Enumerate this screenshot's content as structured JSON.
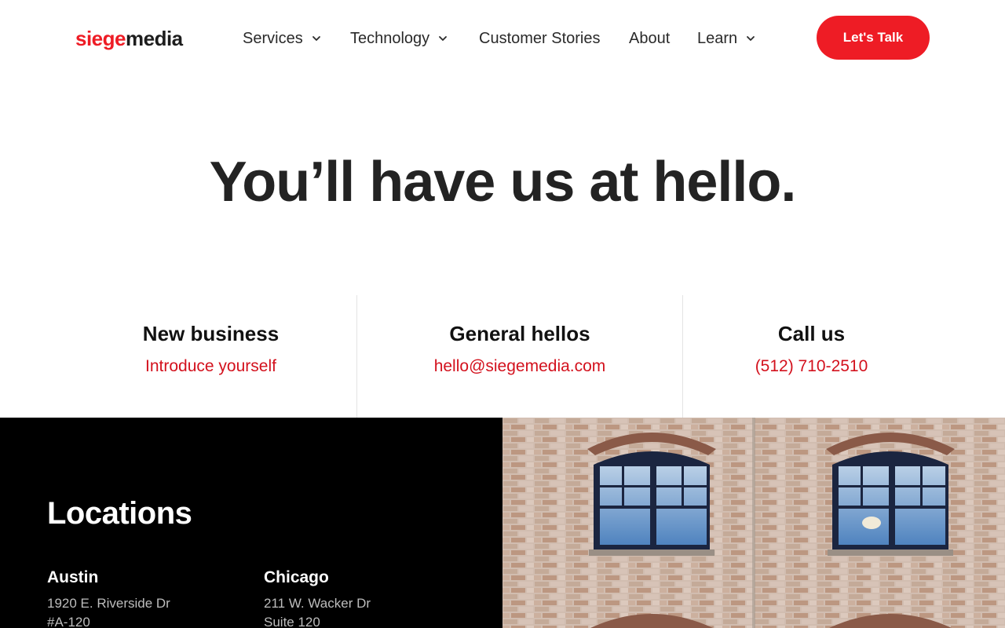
{
  "header": {
    "logo_part1": "siege",
    "logo_part2": "media",
    "nav": [
      {
        "label": "Services",
        "has_dropdown": true
      },
      {
        "label": "Technology",
        "has_dropdown": true
      },
      {
        "label": "Customer Stories",
        "has_dropdown": false
      },
      {
        "label": "About",
        "has_dropdown": false
      },
      {
        "label": "Learn",
        "has_dropdown": true
      }
    ],
    "cta_label": "Let's Talk"
  },
  "hero": {
    "title": "You’ll have us at hello."
  },
  "contacts": [
    {
      "heading": "New business",
      "link": "Introduce yourself"
    },
    {
      "heading": "General hellos",
      "link": "hello@siegemedia.com"
    },
    {
      "heading": "Call us",
      "link": "(512) 710-2510"
    }
  ],
  "locations": {
    "title": "Locations",
    "cities": [
      {
        "name": "Austin",
        "line1": "1920 E. Riverside Dr",
        "line2": "#A-120"
      },
      {
        "name": "Chicago",
        "line1": "211 W. Wacker Dr",
        "line2": "Suite 120"
      }
    ]
  },
  "colors": {
    "brand_red": "#ee1c25",
    "link_red": "#d3111d",
    "dark": "#232323",
    "locations_bg": "#000000"
  },
  "icons": {
    "dropdown": "chevron-down-icon",
    "photo": "brick-building-windows-image"
  }
}
